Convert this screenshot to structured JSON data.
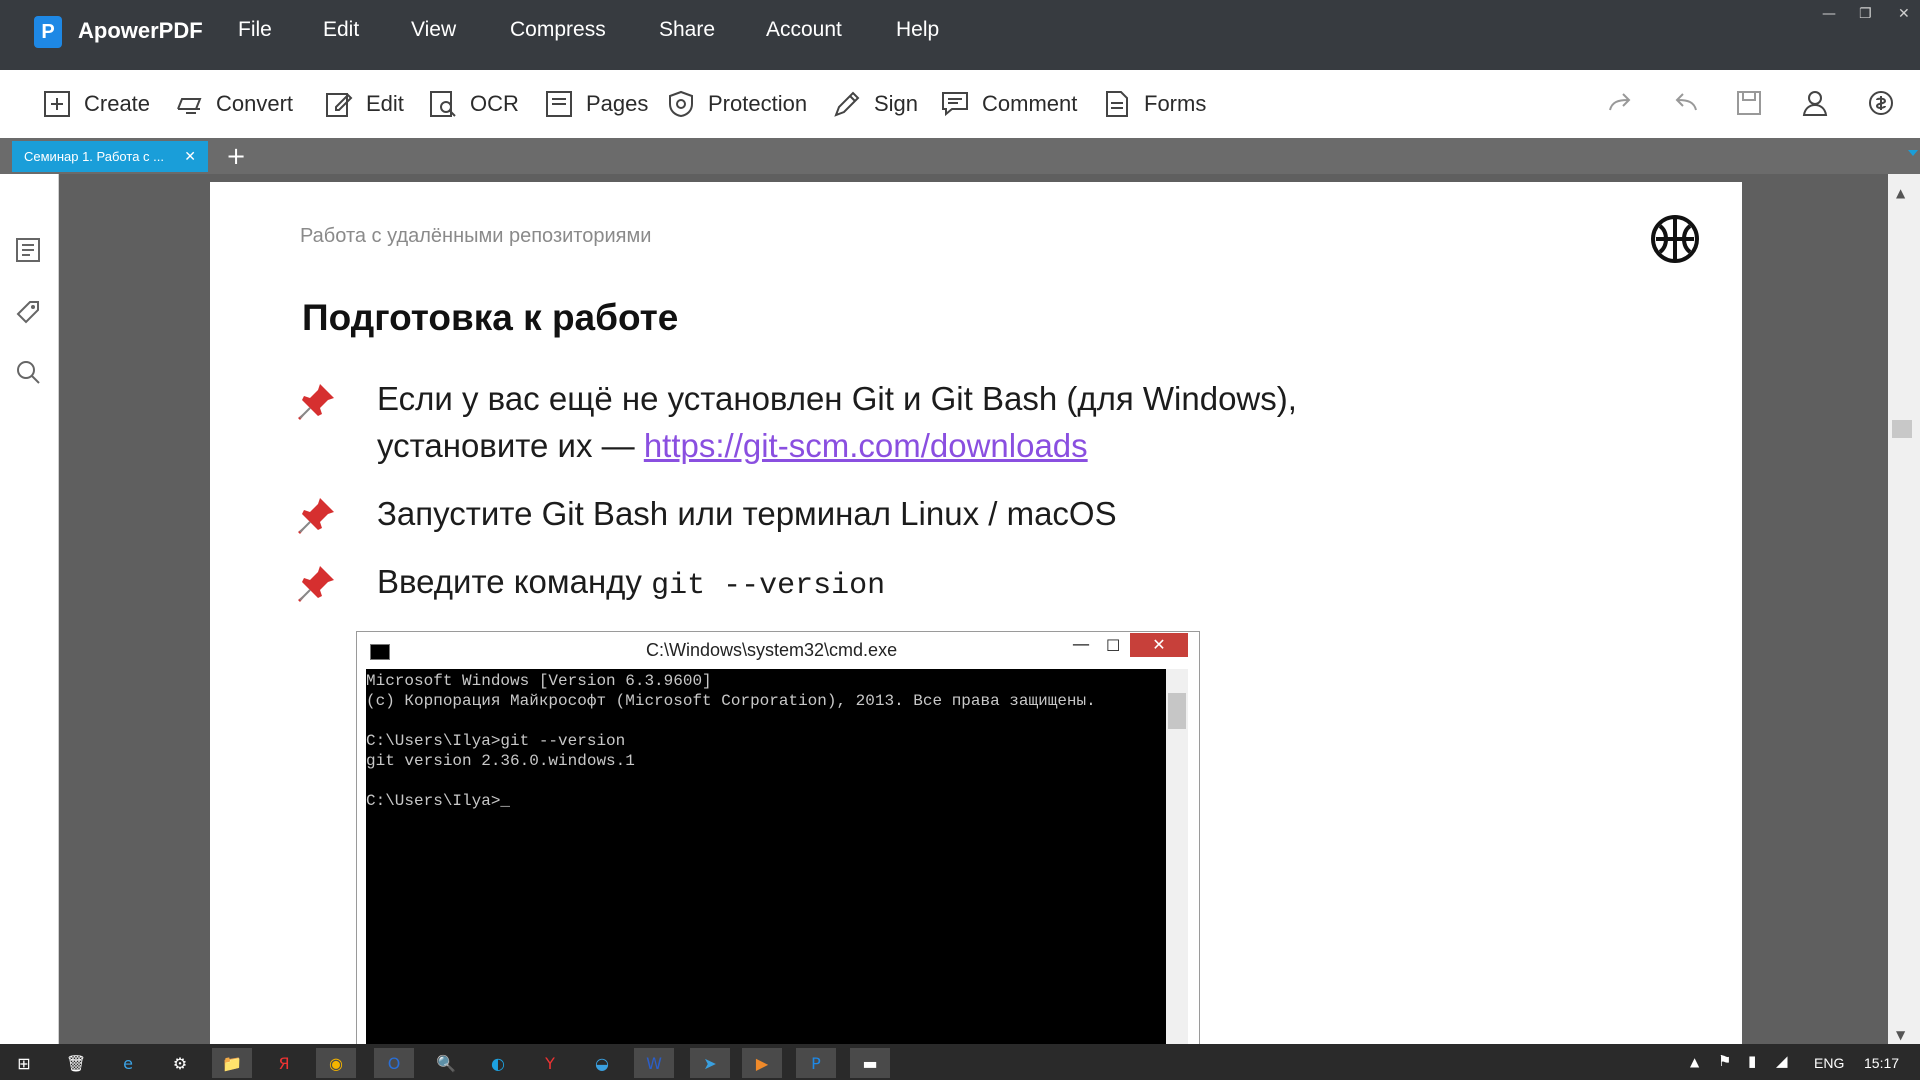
{
  "app": {
    "name": "ApowerPDF",
    "logo_letter": "P",
    "menu": [
      "File",
      "Edit",
      "View",
      "Compress",
      "Share",
      "Account",
      "Help"
    ]
  },
  "toolbar": {
    "tools": [
      {
        "label": "Create",
        "icon": "plus-square-icon"
      },
      {
        "label": "Convert",
        "icon": "convert-icon"
      },
      {
        "label": "Edit",
        "icon": "edit-icon"
      },
      {
        "label": "OCR",
        "icon": "ocr-icon"
      },
      {
        "label": "Pages",
        "icon": "pages-icon"
      },
      {
        "label": "Protection",
        "icon": "shield-icon"
      },
      {
        "label": "Sign",
        "icon": "pen-icon"
      },
      {
        "label": "Comment",
        "icon": "comment-icon"
      },
      {
        "label": "Forms",
        "icon": "forms-icon"
      }
    ],
    "right_icons": [
      "redo-icon",
      "undo-icon",
      "save-icon",
      "user-icon",
      "currency-icon"
    ]
  },
  "tabs": [
    {
      "label": "Семинар 1. Работа с ...",
      "active": true
    }
  ],
  "document": {
    "header": "Работа с удалёнными репозиториями",
    "heading": "Подготовка к работе",
    "bullets": [
      {
        "line1": "Если у вас ещё не установлен Git и Git Bash (для Windows),",
        "line2_prefix": "установите их — ",
        "link": "https://git-scm.com/downloads"
      },
      {
        "text": "Запустите Git Bash или терминал Linux / macOS"
      },
      {
        "text_prefix": "Введите команду ",
        "code": "git --version"
      }
    ],
    "bullet_icon": "pushpin-icon"
  },
  "cmd": {
    "title": "C:\\Windows\\system32\\cmd.exe",
    "lines": [
      "Microsoft Windows [Version 6.3.9600]",
      "(c) Корпорация Майкрософт (Microsoft Corporation), 2013. Все права защищены.",
      "",
      "C:\\Users\\Ilya>git --version",
      "git version 2.36.0.windows.1",
      "",
      "C:\\Users\\Ilya>_"
    ]
  },
  "taskbar": {
    "lang": "ENG",
    "time": "15:17"
  },
  "colors": {
    "titlebar": "#373b40",
    "tab_active": "#1a9ed9",
    "link": "#8a4fe0",
    "close_red": "#c7403a"
  }
}
